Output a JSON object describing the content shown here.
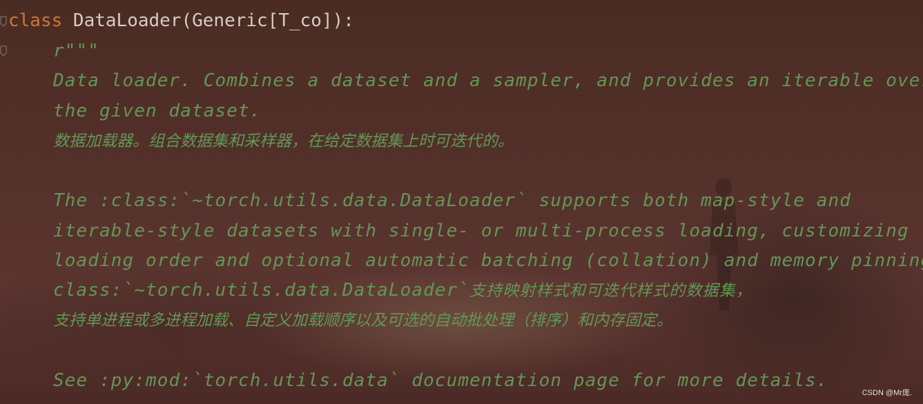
{
  "code": {
    "line1": {
      "keyword": "class",
      "declaration": " DataLoader(Generic[T_co]):"
    },
    "lines": [
      "r\"\"\"",
      "Data loader. Combines a dataset and a sampler, and provides an iterable over",
      "the given dataset.",
      "数据加载器。组合数据集和采样器，在给定数据集上时可迭代的。",
      "The :class:`~torch.utils.data.DataLoader` supports both map-style and",
      "iterable-style datasets with single- or multi-process loading, customizing",
      "loading order and optional automatic batching (collation) and memory pinning.",
      "class:`~torch.utils.data.DataLoader`",
      "支持映射样式和可迭代样式的数据集，",
      "支持单进程或多进程加载、自定义加载顺序以及可选的自动批处理（排序）和内存固定。",
      "See :py:mod:`torch.utils.data` documentation page for more details."
    ]
  },
  "watermark": "CSDN @Mr庞.",
  "colors": {
    "keyword": "#cc7832",
    "class_name": "#d4ccc6",
    "docstring": "#629755",
    "background": "#53302a"
  },
  "icons": [
    "fold-marker-icon",
    "fold-marker-icon"
  ]
}
